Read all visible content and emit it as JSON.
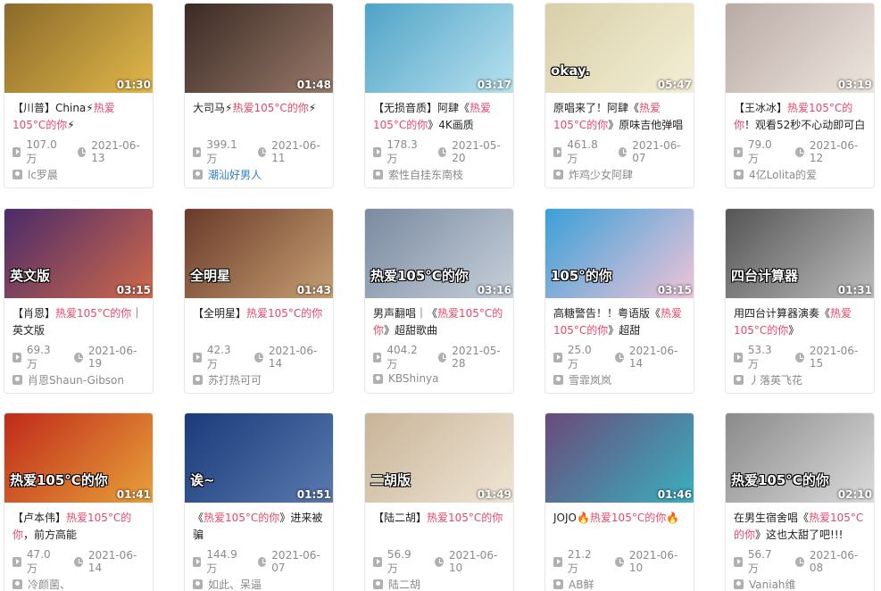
{
  "cards": [
    {
      "title_pre": "【川普】China⚡",
      "title_hl": "热爱105°C的你",
      "title_post": "⚡",
      "duration": "01:30",
      "views": "107.0万",
      "date": "2021-06-13",
      "author": "lc罗晨",
      "author_link": false,
      "caption": "",
      "bg1": "#8a6a2a",
      "bg2": "#e2b84a"
    },
    {
      "title_pre": "大司马⚡",
      "title_hl": "热爱105°C的你",
      "title_post": "⚡",
      "duration": "01:48",
      "views": "399.1万",
      "date": "2021-06-11",
      "author": "潮汕好男人",
      "author_link": true,
      "caption": "",
      "bg1": "#3a2a24",
      "bg2": "#9a7a6a"
    },
    {
      "title_pre": "【无损音质】阿肆《",
      "title_hl": "热爱105°C的你",
      "title_post": "》4K画质",
      "duration": "03:17",
      "views": "178.3万",
      "date": "2021-05-20",
      "author": "索性自挂东南枝",
      "author_link": false,
      "caption": "",
      "bg1": "#4fa3c7",
      "bg2": "#b9e2ef"
    },
    {
      "title_pre": "原唱来了！阿肆《",
      "title_hl": "热爱105°C的你",
      "title_post": "》原味吉他弹唱",
      "duration": "05:47",
      "views": "461.8万",
      "date": "2021-06-07",
      "author": "炸鸡少女阿肆",
      "author_link": false,
      "caption": "okay.",
      "bg1": "#d8cfa8",
      "bg2": "#f4efd6"
    },
    {
      "title_pre": "【王冰冰】",
      "title_hl": "热爱105°C的你",
      "title_post": "！观看52秒不心动即可白",
      "duration": "03:19",
      "views": "79.0万",
      "date": "2021-06-12",
      "author": "4亿Lolita的爱",
      "author_link": false,
      "caption": "",
      "bg1": "#b9aaa4",
      "bg2": "#efe6e0"
    },
    {
      "title_pre": "【肖恩】",
      "title_hl": "热爱105°C的你",
      "title_post": "｜英文版",
      "duration": "03:15",
      "views": "69.3万",
      "date": "2021-06-19",
      "author": "肖恩Shaun-Gibson",
      "author_link": false,
      "caption": "英文版",
      "bg1": "#4a2a6a",
      "bg2": "#d06a4a"
    },
    {
      "title_pre": "【全明星】",
      "title_hl": "热爱105°C的你",
      "title_post": "",
      "duration": "01:43",
      "views": "42.3万",
      "date": "2021-06-14",
      "author": "苏打热可可",
      "author_link": false,
      "caption": "全明星",
      "bg1": "#6a3a2a",
      "bg2": "#c7a072"
    },
    {
      "title_pre": "男声翻唱｜《",
      "title_hl": "热爱105°C的你",
      "title_post": "》超甜歌曲",
      "duration": "03:16",
      "views": "404.2万",
      "date": "2021-05-28",
      "author": "KBShinya",
      "author_link": false,
      "caption": "热爱105°C的你",
      "bg1": "#7a8aa0",
      "bg2": "#c7d0da"
    },
    {
      "title_pre": "高糖警告！！粤语版《",
      "title_hl": "热爱105°C的你",
      "title_post": "》超甜",
      "duration": "03:15",
      "views": "25.0万",
      "date": "2021-06-14",
      "author": "雪霏岚岚",
      "author_link": false,
      "caption": "105°的你",
      "bg1": "#3aa0d8",
      "bg2": "#f1c4d8"
    },
    {
      "title_pre": "用四台计算器演奏《",
      "title_hl": "热爱105°C的你",
      "title_post": "》",
      "duration": "01:31",
      "views": "53.3万",
      "date": "2021-06-15",
      "author": "丿落英飞花",
      "author_link": false,
      "caption": "四台计算器",
      "bg1": "#555555",
      "bg2": "#bdbdbd"
    },
    {
      "title_pre": "【卢本伟】",
      "title_hl": "热爱105°C的你",
      "title_post": "，前方高能",
      "duration": "01:41",
      "views": "47.0万",
      "date": "2021-06-14",
      "author": "冷颜菌、",
      "author_link": false,
      "caption": "热爱105°C的你",
      "bg1": "#c02a1a",
      "bg2": "#e8a23a"
    },
    {
      "title_pre": "《",
      "title_hl": "热爱105°C的你",
      "title_post": "》进来被骗",
      "duration": "01:51",
      "views": "144.9万",
      "date": "2021-06-07",
      "author": "如此、呆逼",
      "author_link": false,
      "caption": "诶~",
      "bg1": "#1a3a7a",
      "bg2": "#5a7ab0"
    },
    {
      "title_pre": "【陆二胡】",
      "title_hl": "热爱105°C的你",
      "title_post": "",
      "duration": "01:49",
      "views": "56.9万",
      "date": "2021-06-10",
      "author": "陆二胡",
      "author_link": false,
      "caption": "二胡版",
      "bg1": "#c8b498",
      "bg2": "#f0e6d6"
    },
    {
      "title_pre": "JOJO🔥",
      "title_hl": "热爱105°C的你",
      "title_post": "🔥",
      "duration": "01:46",
      "views": "21.2万",
      "date": "2021-06-10",
      "author": "AB鲜",
      "author_link": false,
      "caption": "",
      "bg1": "#6a4a7a",
      "bg2": "#3ab0c0"
    },
    {
      "title_pre": "在男生宿舍唱《",
      "title_hl": "热爱105°C的你",
      "title_post": "》这也太甜了吧!!!",
      "duration": "02:10",
      "views": "56.7万",
      "date": "2021-06-08",
      "author": "Vaniah维",
      "author_link": false,
      "caption": "热爱105°C的你",
      "bg1": "#8a8a8a",
      "bg2": "#dcdcdc"
    }
  ]
}
